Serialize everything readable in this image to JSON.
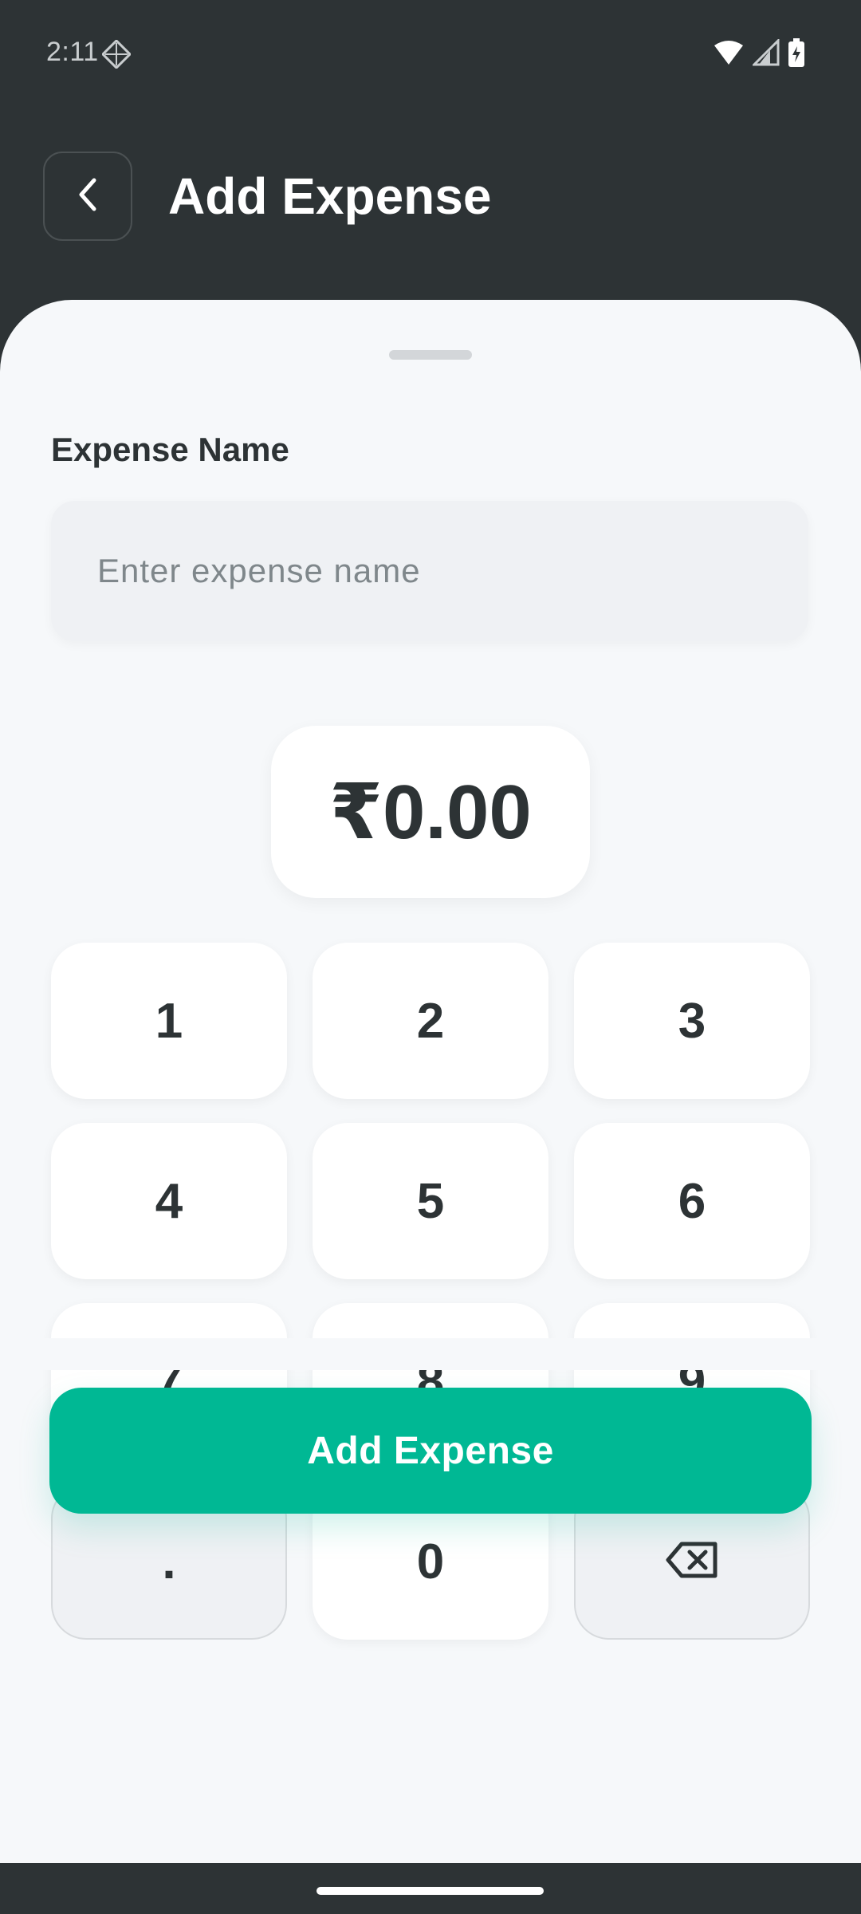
{
  "status_bar": {
    "time": "2:11",
    "icons": [
      "app-notification-icon",
      "wifi-icon",
      "signal-icon",
      "battery-icon"
    ]
  },
  "header": {
    "back_icon": "chevron-left-icon",
    "title": "Add Expense"
  },
  "form": {
    "name_label": "Expense Name",
    "name_placeholder": "Enter expense name",
    "name_value": ""
  },
  "amount": {
    "display": "₹0.00"
  },
  "keypad": {
    "keys": [
      "1",
      "2",
      "3",
      "4",
      "5",
      "6",
      "7",
      "8",
      "9",
      ".",
      "0"
    ],
    "backspace_icon": "backspace-icon"
  },
  "submit": {
    "label": "Add Expense"
  },
  "colors": {
    "header_background": "#2d3335",
    "sheet_background": "#f6f8fa",
    "accent": "#00b894",
    "text_dark": "#2d3335"
  }
}
